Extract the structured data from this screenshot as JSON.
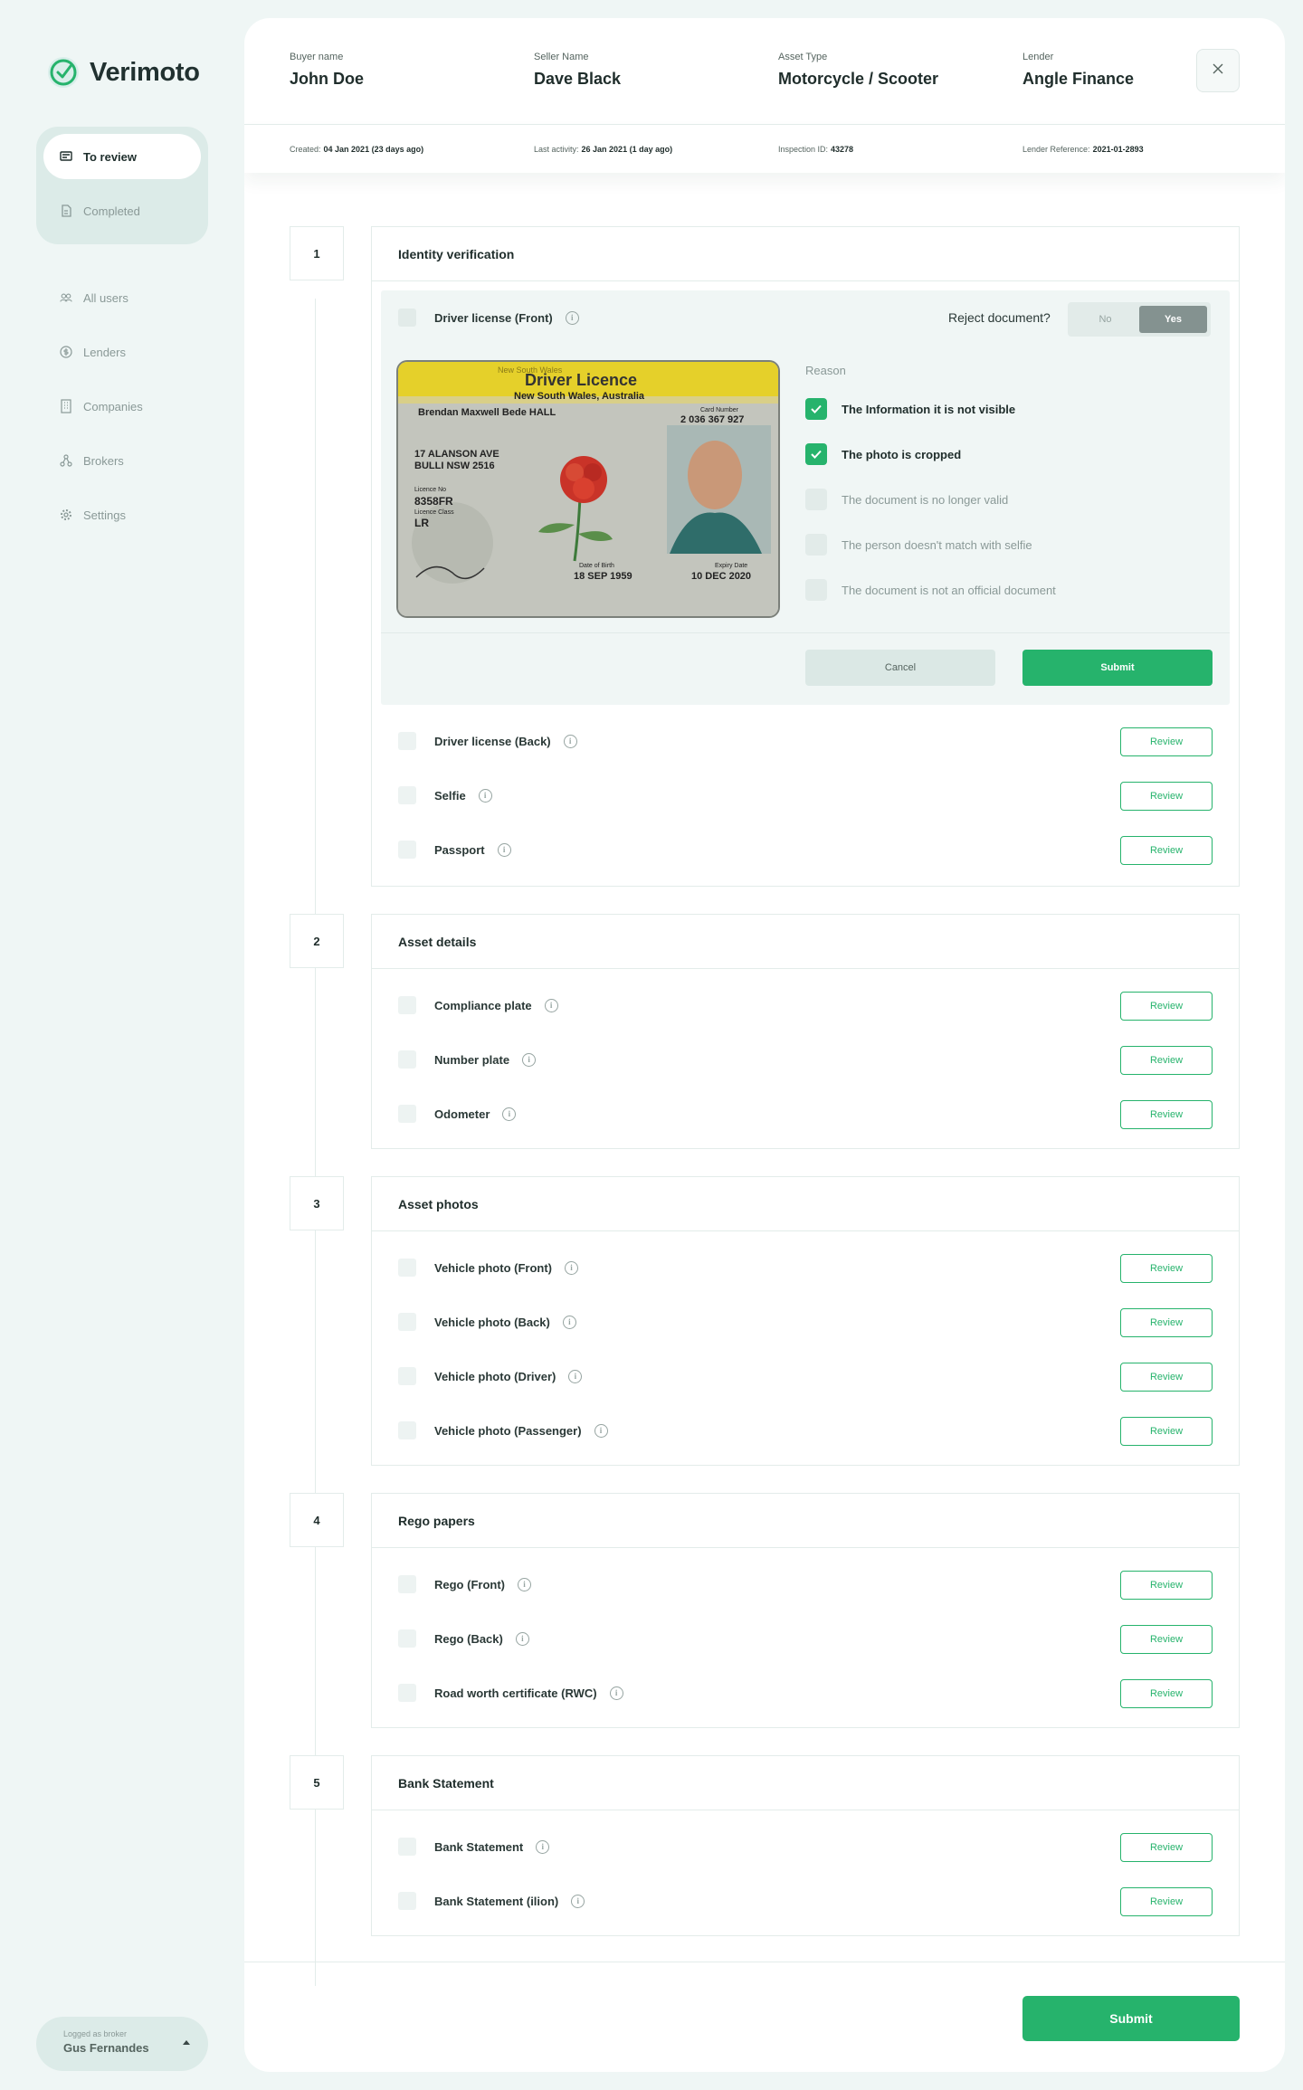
{
  "brand": {
    "name": "Verimoto",
    "accent": "#26b36c"
  },
  "nav": {
    "primary": [
      {
        "label": "To review",
        "icon": "inbox-icon"
      },
      {
        "label": "Completed",
        "icon": "document-icon"
      }
    ],
    "secondary": [
      {
        "label": "All users",
        "icon": "users-icon"
      },
      {
        "label": "Lenders",
        "icon": "dollar-icon"
      },
      {
        "label": "Companies",
        "icon": "building-icon"
      },
      {
        "label": "Brokers",
        "icon": "network-icon"
      },
      {
        "label": "Settings",
        "icon": "gear-icon"
      }
    ]
  },
  "broker": {
    "caption": "Logged as broker",
    "name": "Gus Fernandes"
  },
  "header": {
    "fields": [
      {
        "label": "Buyer name",
        "value": "John Doe"
      },
      {
        "label": "Seller Name",
        "value": "Dave Black"
      },
      {
        "label": "Asset Type",
        "value": "Motorcycle / Scooter"
      },
      {
        "label": "Lender",
        "value": "Angle Finance"
      }
    ],
    "meta": [
      {
        "label": "Created:",
        "value": "04 Jan 2021 (23 days ago)"
      },
      {
        "label": "Last activity:",
        "value": "26 Jan 2021 (1 day ago)"
      },
      {
        "label": "Inspection ID:",
        "value": "43278"
      },
      {
        "label": "Lender Reference:",
        "value": "2021-01-2893"
      }
    ]
  },
  "sections": [
    {
      "number": "1",
      "title": "Identity verification",
      "items": [
        "Driver license (Front)",
        "Driver license (Back)",
        "Selfie",
        "Passport"
      ]
    },
    {
      "number": "2",
      "title": "Asset details",
      "items": [
        "Compliance plate",
        "Number plate",
        "Odometer"
      ]
    },
    {
      "number": "3",
      "title": "Asset photos",
      "items": [
        "Vehicle photo (Front)",
        "Vehicle photo (Back)",
        "Vehicle photo (Driver)",
        "Vehicle photo (Passenger)"
      ]
    },
    {
      "number": "4",
      "title": "Rego papers",
      "items": [
        "Rego (Front)",
        "Rego (Back)",
        "Road worth certificate (RWC)"
      ]
    },
    {
      "number": "5",
      "title": "Bank Statement",
      "items": [
        "Bank Statement",
        "Bank Statement (ilion)"
      ]
    }
  ],
  "review_label": "Review",
  "reject": {
    "question": "Reject document?",
    "no": "No",
    "yes": "Yes",
    "selected": "Yes",
    "reason_title": "Reason",
    "reasons": [
      {
        "label": "The Information it is not visible",
        "checked": true
      },
      {
        "label": "The photo is cropped",
        "checked": true
      },
      {
        "label": "The document is no longer valid",
        "checked": false
      },
      {
        "label": "The person doesn't match with selfie",
        "checked": false
      },
      {
        "label": "The document is not an official document",
        "checked": false
      }
    ],
    "cancel": "Cancel",
    "submit": "Submit"
  },
  "license": {
    "state_banner": "New South Wales",
    "title": "Driver Licence",
    "subtitle": "New South Wales, Australia",
    "card_number_label": "Card Number",
    "card_number": "2 036 367 927",
    "name": "Brendan Maxwell Bede HALL",
    "address1": "17 ALANSON AVE",
    "address2": "BULLI NSW 2516",
    "licence_no_label": "Licence No",
    "licence_no": "8358FR",
    "class_label": "Licence Class",
    "class": "LR",
    "dob_label": "Date of Birth",
    "dob": "18 SEP 1959",
    "expiry_label": "Expiry Date",
    "expiry": "10 DEC 2020"
  },
  "footer": {
    "submit": "Submit"
  }
}
